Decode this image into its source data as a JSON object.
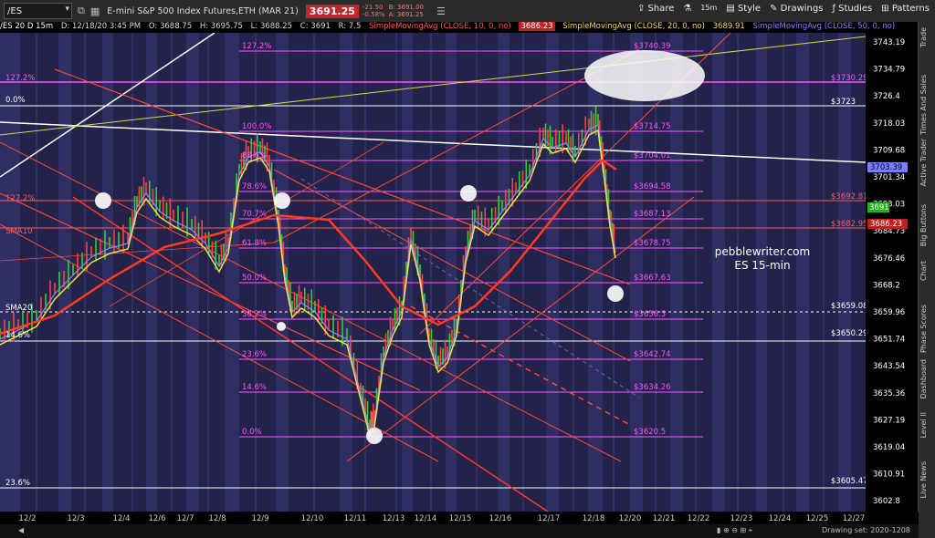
{
  "toolbar": {
    "symbol": "/ES",
    "title": "E-mini S&P 500 Index Futures,ETH (MAR 21)",
    "price": "3691.25",
    "change": [
      "-21.50",
      "-0.58%"
    ],
    "bidask": [
      "B: 3691.00",
      "A: 3691.25"
    ],
    "share": "Share",
    "interval": "15m",
    "style": "Style",
    "drawings": "Drawings",
    "studies": "Studies",
    "patterns": "Patterns"
  },
  "header": {
    "symbol_tf": "/ES 20 D 15m",
    "datetime": "D: 12/18/20 3:45 PM",
    "open": "O: 3688.75",
    "high": "H: 3695.75",
    "low": "L: 3688.25",
    "close": "C: 3691",
    "range": "R: 7.5",
    "sma10": "SimpleMovingAvg (CLOSE, 10, 0, no)",
    "sma10_val": "3686.23",
    "sma20": "SimpleMovingAvg (CLOSE, 20, 0, no)",
    "sma20_val": "3689.91",
    "sma50": "SimpleMovingAvg (CLOSE, 50, 0, no)"
  },
  "watermark": {
    "line1": "pebblewriter.com",
    "line2": "ES 15-min"
  },
  "yaxis_ticks": [
    "3743.19",
    "3734.79",
    "3726.4",
    "3718.03",
    "3709.68",
    "3701.34",
    "3693.03",
    "3684.73",
    "3676.46",
    "3668.2",
    "3659.96",
    "3651.74",
    "3643.54",
    "3635.36",
    "3627.19",
    "3619.04",
    "3610.91",
    "3602.8"
  ],
  "price_labels": {
    "last": "3703.39",
    "last_green": "3691",
    "sma_red": "3686.23"
  },
  "fib_right": [
    "127.2%",
    "100.0%",
    "88.6%",
    "78.6%",
    "70.7%",
    "61.8%",
    "50.0%",
    "38.2%",
    "23.6%",
    "14.6%",
    "0.0%"
  ],
  "fib_right_vals": [
    "$3740.39",
    "$3714.75",
    "$3704.01",
    "$3694.58",
    "$3687.13",
    "$3678.75",
    "$3667.63",
    "$3656.5",
    "$3642.74",
    "$3634.26",
    "$3620.5"
  ],
  "fib_left": [
    "127.2%",
    "0.0%",
    "127.2%",
    "SMA10",
    "SMA20",
    "14.6%",
    "23.6%"
  ],
  "level_vals": [
    "$3730.29",
    "$3723",
    "$3692.81",
    "$3682.95",
    "$3659.08",
    "$3650.29",
    "$3605.47"
  ],
  "xaxis": [
    "12/2",
    "12/3",
    "12/4",
    "12/6",
    "12/7",
    "12/8",
    "12/9",
    "12/10",
    "12/11",
    "12/13",
    "12/14",
    "12/15",
    "12/16",
    "12/17",
    "12/18",
    "12/20",
    "12/21",
    "12/22",
    "12/23",
    "12/24",
    "12/25",
    "12/27"
  ],
  "side_tabs": [
    "Trade",
    "Times And Sales",
    "Active Trader",
    "Big Buttons",
    "Chart",
    "Phase Scores",
    "Dashboard",
    "Level II",
    "Live News"
  ],
  "status": "Drawing set: 2020-1208",
  "colors": {
    "bg": "#22224a",
    "band": "#2e2e62",
    "magenta": "#ff55ff",
    "red": "#ff3030",
    "yellow": "#f0e040",
    "blue": "#8080ff"
  }
}
